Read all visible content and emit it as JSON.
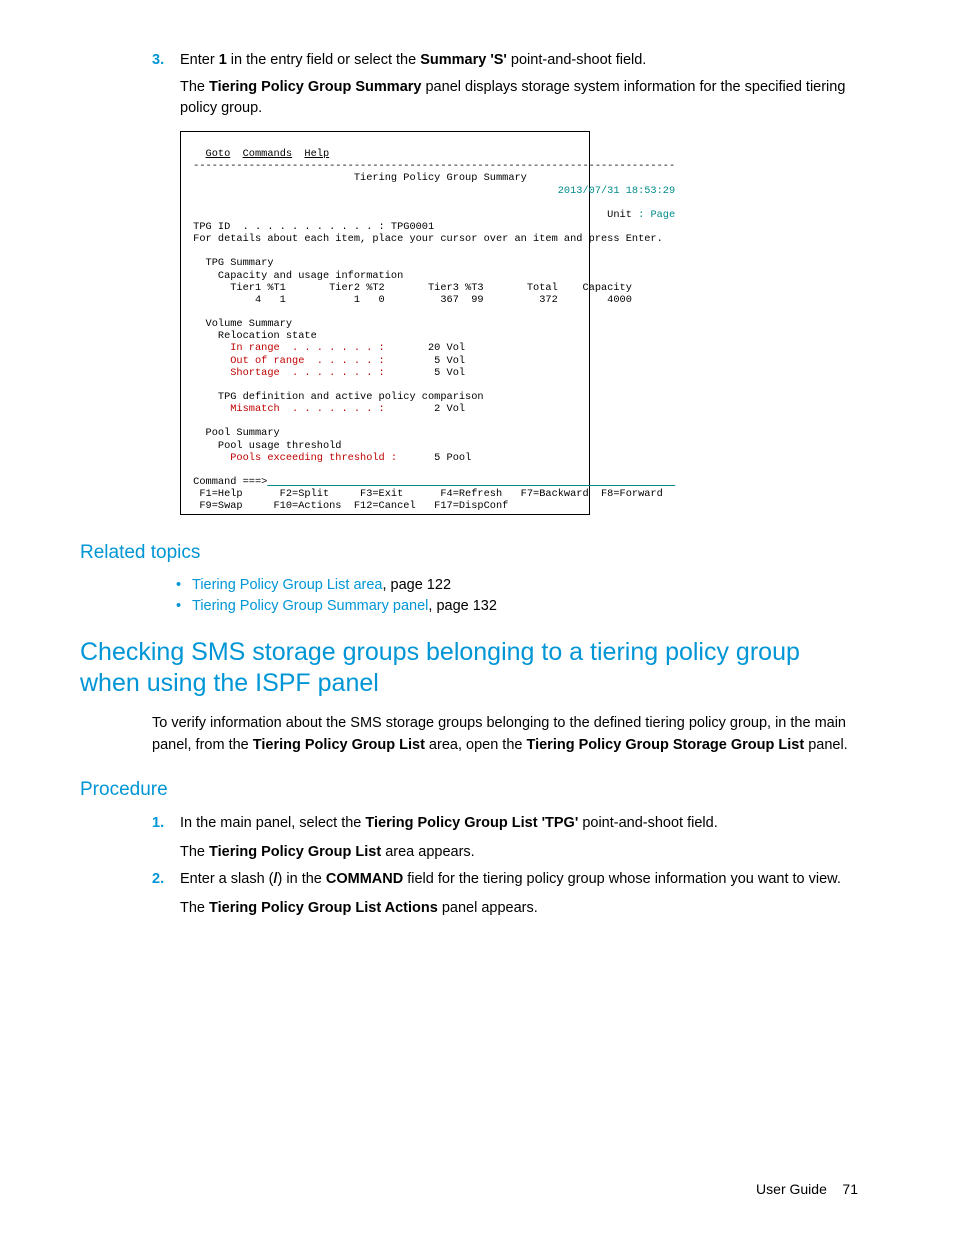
{
  "step3": {
    "num": "3.",
    "line_a": "Enter ",
    "line_b": "1",
    "line_c": " in the entry field or select the ",
    "line_d": "Summary 'S'",
    "line_e": " point-and-shoot field.",
    "para_a": "The ",
    "para_b": "Tiering Policy Group Summary",
    "para_c": " panel displays storage system information for the specified tiering policy group."
  },
  "panel": {
    "menu_goto": "Goto",
    "menu_commands": "Commands",
    "menu_help": "Help",
    "hr": " ------------------------------------------------------------------------------",
    "title": "                           Tiering Policy Group Summary",
    "timestamp": "                                                            2013/07/31 18:53:29",
    "unit_lbl": "                                                                    Unit ",
    "unit_sep": ": ",
    "unit_val": "Page",
    "tpg_id": " TPG ID  . . . . . . . . . . . : TPG0001",
    "hint": " For details about each item, place your cursor over an item and press Enter.",
    "tpg_sum": "   TPG Summary",
    "cap_hdr": "     Capacity and usage information",
    "cap_cols": "       Tier1 %T1       Tier2 %T2       Tier3 %T3       Total    Capacity",
    "cap_vals": "           4   1           1   0         367  99         372        4000",
    "vol_sum": "   Volume Summary",
    "reloc": "     Relocation state",
    "in_range_l": "       In range  . . . . . . . :",
    "in_range_v": "       20 Vol",
    "out_range_l": "       Out of range  . . . . . :",
    "out_range_v": "        5 Vol",
    "shortage_l": "       Shortage  . . . . . . . :",
    "shortage_v": "        5 Vol",
    "tpg_def": "     TPG definition and active policy comparison",
    "mismatch_l": "       Mismatch  . . . . . . . :",
    "mismatch_v": "        2 Vol",
    "pool_sum": "   Pool Summary",
    "pool_thr": "     Pool usage threshold",
    "pool_exc_l": "       Pools exceeding threshold :",
    "pool_exc_v": "      5 Pool",
    "cmd": " Command ===>",
    "cmd_line": "                                                                  ",
    "fkeys1": "  F1=Help      F2=Split     F3=Exit      F4=Refresh   F7=Backward  F8=Forward",
    "fkeys2": "  F9=Swap     F10=Actions  F12=Cancel   F17=DispConf"
  },
  "related": {
    "heading": "Related topics",
    "item1_link": "Tiering Policy Group List area",
    "item1_rest": ", page 122",
    "item2_link": "Tiering Policy Group Summary panel",
    "item2_rest": ", page 132"
  },
  "section": {
    "title": "Checking SMS storage groups belonging to a tiering policy group when using the ISPF panel",
    "intro_a": "To verify information about the SMS storage groups belonging to the defined tiering policy group, in the main panel, from the ",
    "intro_b": "Tiering Policy Group List",
    "intro_c": " area, open the ",
    "intro_d": "Tiering Policy Group Storage Group List",
    "intro_e": " panel."
  },
  "procedure": {
    "heading": "Procedure",
    "s1": {
      "num": "1.",
      "a": "In the main panel, select the ",
      "b": "Tiering Policy Group List 'TPG'",
      "c": " point-and-shoot field.",
      "p_a": "The ",
      "p_b": "Tiering Policy Group List",
      "p_c": " area appears."
    },
    "s2": {
      "num": "2.",
      "a": "Enter a slash (",
      "b": "/",
      "c": ") in the ",
      "d": "COMMAND",
      "e": " field for the tiering policy group whose information you want to view.",
      "p_a": "The ",
      "p_b": "Tiering Policy Group List Actions",
      "p_c": " panel appears."
    }
  },
  "footer": {
    "label": "User Guide",
    "page": "71"
  }
}
